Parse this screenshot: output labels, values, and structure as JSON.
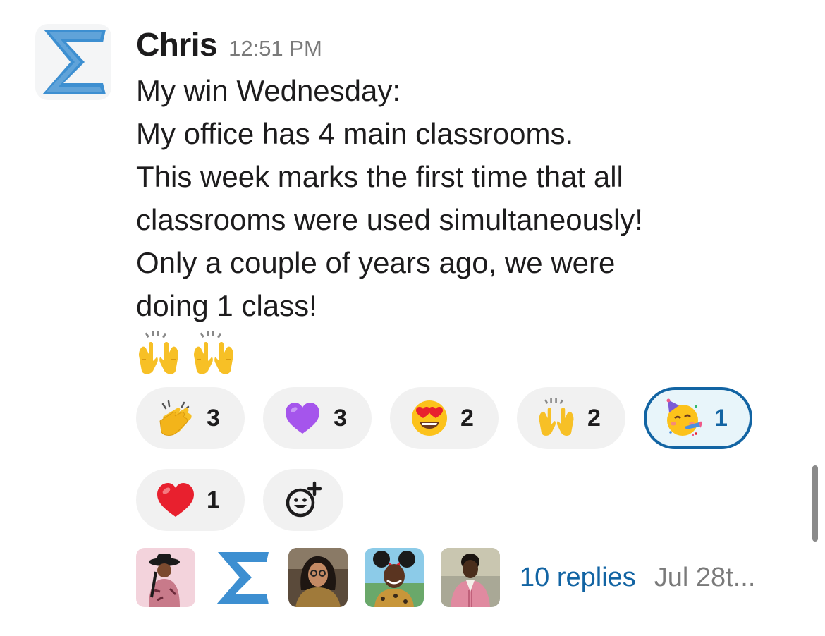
{
  "message": {
    "author": "Chris",
    "time": "12:51 PM",
    "lines": [
      "My win Wednesday:",
      "My office has 4 main classrooms.",
      "This week marks the first time that all",
      "classrooms were used simultaneously!",
      "Only a couple of years ago, we were",
      "doing 1 class!"
    ],
    "inline_emojis": [
      "raising-hands-emoji",
      "raising-hands-emoji"
    ]
  },
  "reactions": [
    {
      "emoji": "clapping-hands-emoji",
      "count": "3",
      "active": false
    },
    {
      "emoji": "purple-heart-emoji",
      "count": "3",
      "active": false
    },
    {
      "emoji": "heart-eyes-emoji",
      "count": "2",
      "active": false
    },
    {
      "emoji": "raising-hands-emoji",
      "count": "2",
      "active": false
    },
    {
      "emoji": "partying-face-emoji",
      "count": "1",
      "active": true
    },
    {
      "emoji": "red-heart-emoji",
      "count": "1",
      "active": false
    }
  ],
  "add_reaction_icon": "add-emoji-icon",
  "thread": {
    "participant_avatars": [
      "avatar-woman-hat",
      "avatar-sigma-logo",
      "avatar-woman-glasses",
      "avatar-woman-mouse-ears",
      "avatar-woman-pink-jacket"
    ],
    "replies_label": "10 replies",
    "date": "Jul 28t..."
  },
  "colors": {
    "link": "#1264a3",
    "sigma_blue": "#3d8fd1",
    "reaction_bg": "#f1f1f1",
    "active_reaction_bg": "#e8f5fa",
    "active_reaction_border": "#1264a3"
  }
}
